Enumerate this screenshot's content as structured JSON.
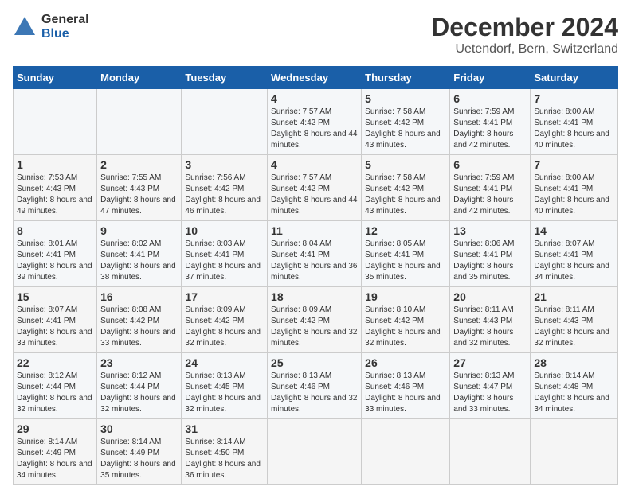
{
  "logo": {
    "text_general": "General",
    "text_blue": "Blue"
  },
  "header": {
    "title": "December 2024",
    "subtitle": "Uetendorf, Bern, Switzerland"
  },
  "calendar": {
    "days_of_week": [
      "Sunday",
      "Monday",
      "Tuesday",
      "Wednesday",
      "Thursday",
      "Friday",
      "Saturday"
    ],
    "weeks": [
      [
        null,
        null,
        null,
        {
          "day": "4",
          "sunrise": "7:57 AM",
          "sunset": "4:42 PM",
          "daylight": "8 hours and 44 minutes."
        },
        {
          "day": "5",
          "sunrise": "7:58 AM",
          "sunset": "4:42 PM",
          "daylight": "8 hours and 43 minutes."
        },
        {
          "day": "6",
          "sunrise": "7:59 AM",
          "sunset": "4:41 PM",
          "daylight": "8 hours and 42 minutes."
        },
        {
          "day": "7",
          "sunrise": "8:00 AM",
          "sunset": "4:41 PM",
          "daylight": "8 hours and 40 minutes."
        }
      ],
      [
        {
          "day": "1",
          "sunrise": "7:53 AM",
          "sunset": "4:43 PM",
          "daylight": "8 hours and 49 minutes."
        },
        {
          "day": "2",
          "sunrise": "7:55 AM",
          "sunset": "4:43 PM",
          "daylight": "8 hours and 47 minutes."
        },
        {
          "day": "3",
          "sunrise": "7:56 AM",
          "sunset": "4:42 PM",
          "daylight": "8 hours and 46 minutes."
        },
        {
          "day": "4",
          "sunrise": "7:57 AM",
          "sunset": "4:42 PM",
          "daylight": "8 hours and 44 minutes."
        },
        {
          "day": "5",
          "sunrise": "7:58 AM",
          "sunset": "4:42 PM",
          "daylight": "8 hours and 43 minutes."
        },
        {
          "day": "6",
          "sunrise": "7:59 AM",
          "sunset": "4:41 PM",
          "daylight": "8 hours and 42 minutes."
        },
        {
          "day": "7",
          "sunrise": "8:00 AM",
          "sunset": "4:41 PM",
          "daylight": "8 hours and 40 minutes."
        }
      ],
      [
        {
          "day": "8",
          "sunrise": "8:01 AM",
          "sunset": "4:41 PM",
          "daylight": "8 hours and 39 minutes."
        },
        {
          "day": "9",
          "sunrise": "8:02 AM",
          "sunset": "4:41 PM",
          "daylight": "8 hours and 38 minutes."
        },
        {
          "day": "10",
          "sunrise": "8:03 AM",
          "sunset": "4:41 PM",
          "daylight": "8 hours and 37 minutes."
        },
        {
          "day": "11",
          "sunrise": "8:04 AM",
          "sunset": "4:41 PM",
          "daylight": "8 hours and 36 minutes."
        },
        {
          "day": "12",
          "sunrise": "8:05 AM",
          "sunset": "4:41 PM",
          "daylight": "8 hours and 35 minutes."
        },
        {
          "day": "13",
          "sunrise": "8:06 AM",
          "sunset": "4:41 PM",
          "daylight": "8 hours and 35 minutes."
        },
        {
          "day": "14",
          "sunrise": "8:07 AM",
          "sunset": "4:41 PM",
          "daylight": "8 hours and 34 minutes."
        }
      ],
      [
        {
          "day": "15",
          "sunrise": "8:07 AM",
          "sunset": "4:41 PM",
          "daylight": "8 hours and 33 minutes."
        },
        {
          "day": "16",
          "sunrise": "8:08 AM",
          "sunset": "4:42 PM",
          "daylight": "8 hours and 33 minutes."
        },
        {
          "day": "17",
          "sunrise": "8:09 AM",
          "sunset": "4:42 PM",
          "daylight": "8 hours and 32 minutes."
        },
        {
          "day": "18",
          "sunrise": "8:09 AM",
          "sunset": "4:42 PM",
          "daylight": "8 hours and 32 minutes."
        },
        {
          "day": "19",
          "sunrise": "8:10 AM",
          "sunset": "4:42 PM",
          "daylight": "8 hours and 32 minutes."
        },
        {
          "day": "20",
          "sunrise": "8:11 AM",
          "sunset": "4:43 PM",
          "daylight": "8 hours and 32 minutes."
        },
        {
          "day": "21",
          "sunrise": "8:11 AM",
          "sunset": "4:43 PM",
          "daylight": "8 hours and 32 minutes."
        }
      ],
      [
        {
          "day": "22",
          "sunrise": "8:12 AM",
          "sunset": "4:44 PM",
          "daylight": "8 hours and 32 minutes."
        },
        {
          "day": "23",
          "sunrise": "8:12 AM",
          "sunset": "4:44 PM",
          "daylight": "8 hours and 32 minutes."
        },
        {
          "day": "24",
          "sunrise": "8:13 AM",
          "sunset": "4:45 PM",
          "daylight": "8 hours and 32 minutes."
        },
        {
          "day": "25",
          "sunrise": "8:13 AM",
          "sunset": "4:46 PM",
          "daylight": "8 hours and 32 minutes."
        },
        {
          "day": "26",
          "sunrise": "8:13 AM",
          "sunset": "4:46 PM",
          "daylight": "8 hours and 33 minutes."
        },
        {
          "day": "27",
          "sunrise": "8:13 AM",
          "sunset": "4:47 PM",
          "daylight": "8 hours and 33 minutes."
        },
        {
          "day": "28",
          "sunrise": "8:14 AM",
          "sunset": "4:48 PM",
          "daylight": "8 hours and 34 minutes."
        }
      ],
      [
        {
          "day": "29",
          "sunrise": "8:14 AM",
          "sunset": "4:49 PM",
          "daylight": "8 hours and 34 minutes."
        },
        {
          "day": "30",
          "sunrise": "8:14 AM",
          "sunset": "4:49 PM",
          "daylight": "8 hours and 35 minutes."
        },
        {
          "day": "31",
          "sunrise": "8:14 AM",
          "sunset": "4:50 PM",
          "daylight": "8 hours and 36 minutes."
        },
        null,
        null,
        null,
        null
      ]
    ],
    "first_week": [
      null,
      null,
      null,
      {
        "day": "4",
        "sunrise": "7:57 AM",
        "sunset": "4:42 PM",
        "daylight": "8 hours and 44 minutes."
      },
      {
        "day": "5",
        "sunrise": "7:58 AM",
        "sunset": "4:42 PM",
        "daylight": "8 hours and 43 minutes."
      },
      {
        "day": "6",
        "sunrise": "7:59 AM",
        "sunset": "4:41 PM",
        "daylight": "8 hours and 42 minutes."
      },
      {
        "day": "7",
        "sunrise": "8:00 AM",
        "sunset": "4:41 PM",
        "daylight": "8 hours and 40 minutes."
      }
    ]
  }
}
